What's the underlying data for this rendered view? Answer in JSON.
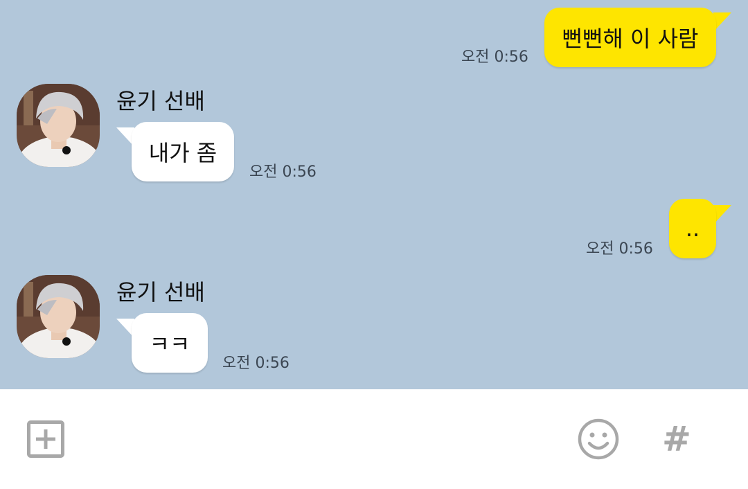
{
  "messages": [
    {
      "from": "me",
      "text": "뻔뻔해 이 사람",
      "time": "오전 0:56"
    },
    {
      "from": "other",
      "sender": "윤기 선배",
      "text": "내가 좀",
      "time": "오전 0:56"
    },
    {
      "from": "me",
      "text": "..",
      "time": "오전 0:56"
    },
    {
      "from": "other",
      "sender": "윤기 선배",
      "text": "ㅋㅋ",
      "time": "오전 0:56"
    }
  ],
  "input_bar": {
    "add_icon": "plus-square-icon",
    "emoji_icon": "smiley-icon",
    "hash_icon": "hashtag-icon",
    "hash_label": "#"
  },
  "colors": {
    "chat_background": "#b2c7da",
    "my_bubble": "#fee500",
    "other_bubble": "#ffffff",
    "icon_gray": "#a8a8a8"
  }
}
